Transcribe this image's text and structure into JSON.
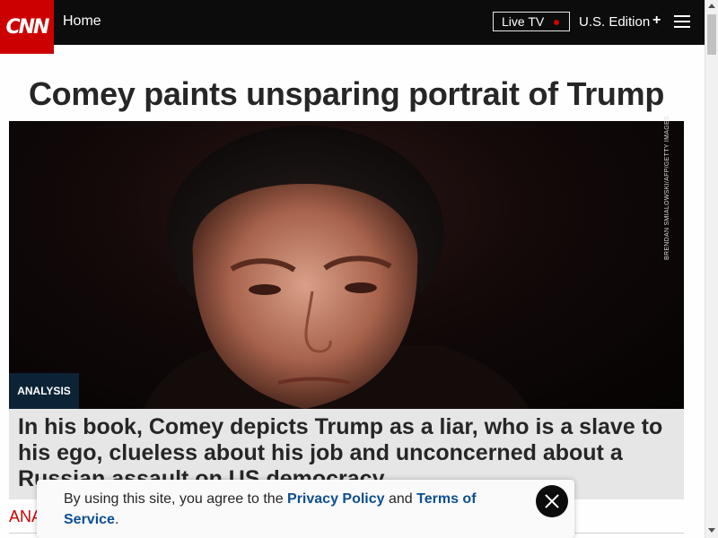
{
  "header": {
    "logo_text": "CNN",
    "home_label": "Home",
    "live_tv_label": "Live TV",
    "edition_label": "U.S. Edition",
    "edition_plus": "+",
    "brand_color": "#cc0000"
  },
  "article": {
    "headline": "Comey paints unsparing portrait of Trump",
    "image_credit": "BRENDAN SMIALOWSKI/AFP/GETTY IMAGES",
    "tag": "ANALYSIS",
    "caption": "In his book, Comey depicts Trump as a liar, who is a slave to his ego, clueless about his job and unconcerned about a Russian assault on US democracy",
    "byline_partial": "ANA"
  },
  "cookie_banner": {
    "text_before": "By using this site, you agree to the ",
    "privacy_link": "Privacy Policy",
    "text_middle": " and ",
    "terms_link": "Terms of Service",
    "text_after": ".",
    "close_icon": "close-icon"
  }
}
